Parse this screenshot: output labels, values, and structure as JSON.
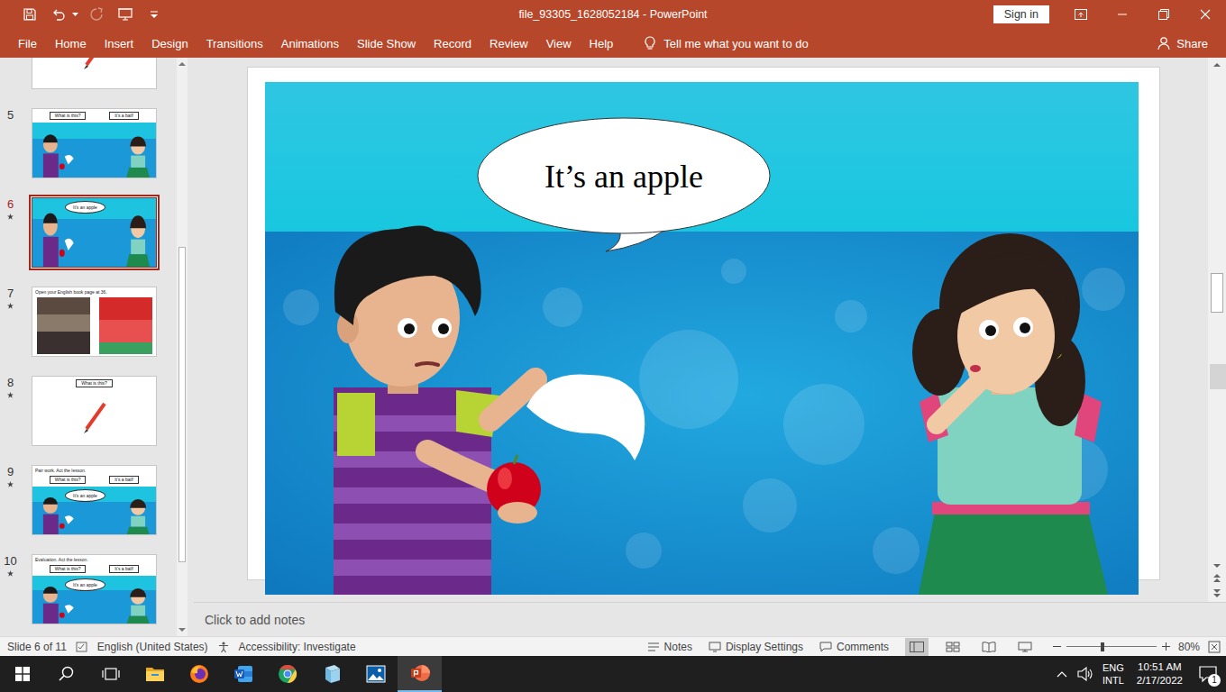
{
  "window": {
    "title": "file_93305_1628052184 - PowerPoint"
  },
  "account": {
    "sign_in": "Sign in"
  },
  "ribbon_tabs": [
    {
      "label": "File",
      "selected": false
    },
    {
      "label": "Home",
      "selected": false
    },
    {
      "label": "Insert",
      "selected": false
    },
    {
      "label": "Design",
      "selected": false
    },
    {
      "label": "Transitions",
      "selected": false
    },
    {
      "label": "Animations",
      "selected": false
    },
    {
      "label": "Slide Show",
      "selected": false
    },
    {
      "label": "Record",
      "selected": false
    },
    {
      "label": "Review",
      "selected": false
    },
    {
      "label": "View",
      "selected": false
    },
    {
      "label": "Help",
      "selected": false
    }
  ],
  "tell_me": {
    "placeholder": "Tell me what you want to do"
  },
  "share": {
    "label": "Share"
  },
  "thumbnails": [
    {
      "number": "",
      "starred": false,
      "selected": false,
      "kind": "pencil",
      "heading": "",
      "labels": [],
      "bubble": ""
    },
    {
      "number": "5",
      "starred": false,
      "selected": false,
      "kind": "scene",
      "heading": "",
      "labels": [
        "What is this?",
        "It’s a ball!"
      ],
      "bubble": ""
    },
    {
      "number": "6",
      "starred": true,
      "selected": true,
      "kind": "scene",
      "heading": "",
      "labels": [],
      "bubble": "It’s an apple"
    },
    {
      "number": "7",
      "starred": true,
      "selected": false,
      "kind": "book",
      "heading": "Open your English book page at 36.",
      "labels": [],
      "bubble": ""
    },
    {
      "number": "8",
      "starred": true,
      "selected": false,
      "kind": "pencil",
      "heading": "",
      "labels": [
        "What is this?"
      ],
      "bubble": ""
    },
    {
      "number": "9",
      "starred": true,
      "selected": false,
      "kind": "scene",
      "heading": "Pair work. Act the lesson.",
      "labels": [
        "What is this?",
        "It’s a ball!"
      ],
      "bubble": "It’s an apple"
    },
    {
      "number": "10",
      "starred": true,
      "selected": false,
      "kind": "scene",
      "heading": "Evaluation. Act the lesson.",
      "labels": [
        "What is this?",
        "It’s a ball!"
      ],
      "bubble": "It’s an apple"
    }
  ],
  "slide": {
    "bubble": "It’s an apple"
  },
  "notes": {
    "placeholder": "Click to add notes"
  },
  "status_bar": {
    "slide_info": "Slide 6 of 11",
    "language": "English (United States)",
    "accessibility": "Accessibility: Investigate",
    "notes": "Notes",
    "display_settings": "Display Settings",
    "comments": "Comments",
    "views": [
      {
        "kind": "normal",
        "selected": true
      },
      {
        "kind": "sorter",
        "selected": false
      },
      {
        "kind": "reading",
        "selected": false
      },
      {
        "kind": "slideshow",
        "selected": false
      }
    ],
    "zoom": "80%",
    "zoom_level": 0.4
  },
  "taskbar": {
    "apps": [
      {
        "kind": "start",
        "selected": false
      },
      {
        "kind": "search",
        "selected": false
      },
      {
        "kind": "taskview",
        "selected": false
      },
      {
        "kind": "explorer",
        "selected": false
      },
      {
        "kind": "firefox",
        "selected": false
      },
      {
        "kind": "word",
        "selected": false
      },
      {
        "kind": "chrome",
        "selected": false
      },
      {
        "kind": "notepad",
        "selected": false
      },
      {
        "kind": "photos",
        "selected": false
      },
      {
        "kind": "powerpoint",
        "selected": true
      }
    ],
    "tray": {
      "language": [
        "ENG",
        "INTL"
      ],
      "time": "10:51 AM",
      "date": "2/17/2022",
      "notifications": "1"
    }
  }
}
